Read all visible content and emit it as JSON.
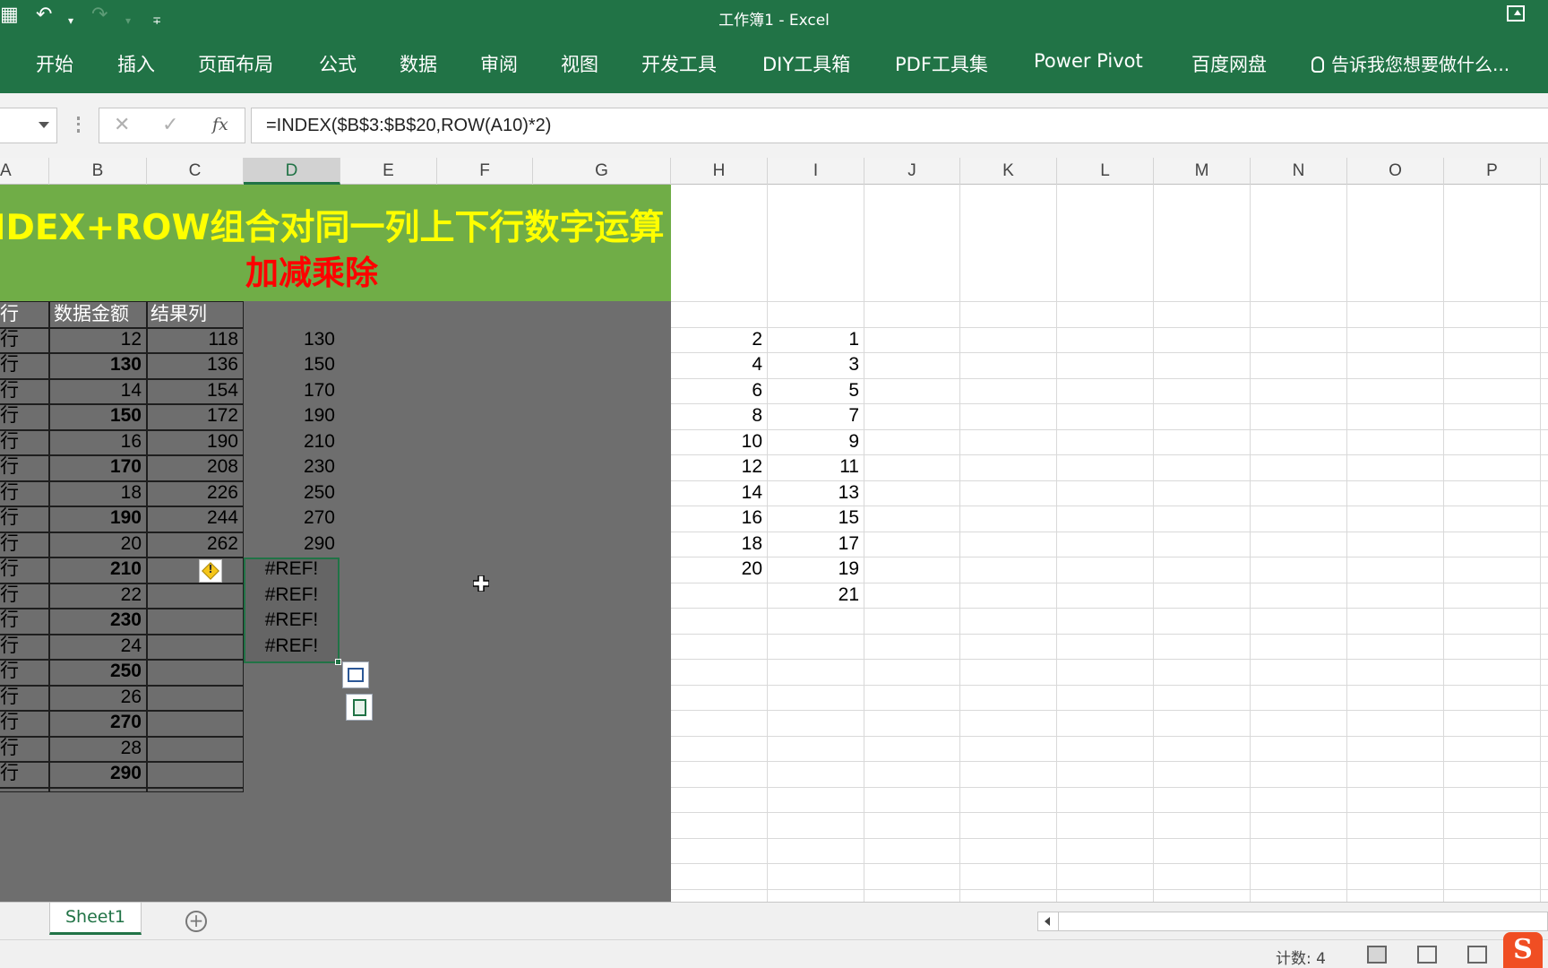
{
  "window": {
    "title": "工作簿1 - Excel"
  },
  "quick_access": {
    "undo": "↶",
    "redo": "↷",
    "dropdown": "▾",
    "customize": "∓"
  },
  "ribbon": {
    "tabs": [
      "开始",
      "插入",
      "页面布局",
      "公式",
      "数据",
      "审阅",
      "视图",
      "开发工具",
      "DIY工具箱",
      "PDF工具集",
      "Power Pivot",
      "百度网盘"
    ],
    "tell_me": "告诉我您想要做什么..."
  },
  "formula_bar": {
    "cancel": "✕",
    "enter": "✓",
    "fx": "fx",
    "formula": "=INDEX($B$3:$B$20,ROW(A10)*2)"
  },
  "columns": [
    "A",
    "B",
    "C",
    "D",
    "E",
    "F",
    "G",
    "H",
    "I",
    "J",
    "K",
    "L",
    "M",
    "N",
    "O",
    "P"
  ],
  "banner": {
    "line1": "IDEX+ROW组合对同一列上下行数字运算",
    "line2": "加减乘除"
  },
  "table": {
    "headers": [
      "行",
      "数据金额",
      "结果列"
    ],
    "rows": [
      {
        "a": "行",
        "b": "12",
        "c": "118"
      },
      {
        "a": "行",
        "b": "130",
        "c": "136"
      },
      {
        "a": "行",
        "b": "14",
        "c": "154"
      },
      {
        "a": "行",
        "b": "150",
        "c": "172"
      },
      {
        "a": "行",
        "b": "16",
        "c": "190"
      },
      {
        "a": "行",
        "b": "170",
        "c": "208"
      },
      {
        "a": "行",
        "b": "18",
        "c": "226"
      },
      {
        "a": "行",
        "b": "190",
        "c": "244"
      },
      {
        "a": "行",
        "b": "20",
        "c": "262"
      },
      {
        "a": "行",
        "b": "210",
        "c": ""
      },
      {
        "a": "行",
        "b": "22",
        "c": ""
      },
      {
        "a": "行",
        "b": "230",
        "c": ""
      },
      {
        "a": "行",
        "b": "24",
        "c": ""
      },
      {
        "a": "行",
        "b": "250",
        "c": ""
      },
      {
        "a": "行",
        "b": "26",
        "c": ""
      },
      {
        "a": "行",
        "b": "270",
        "c": ""
      },
      {
        "a": "行",
        "b": "28",
        "c": ""
      },
      {
        "a": "行",
        "b": "290",
        "c": ""
      }
    ]
  },
  "column_d": [
    "130",
    "150",
    "170",
    "190",
    "210",
    "230",
    "250",
    "270",
    "290",
    "#REF!",
    "#REF!",
    "#REF!",
    "#REF!"
  ],
  "column_h": [
    "2",
    "4",
    "6",
    "8",
    "10",
    "12",
    "14",
    "16",
    "18",
    "20"
  ],
  "column_i": [
    "1",
    "3",
    "5",
    "7",
    "9",
    "11",
    "13",
    "15",
    "17",
    "19",
    "21"
  ],
  "sheets": {
    "active": "Sheet1",
    "add": "+"
  },
  "status": {
    "count": "计数: 4"
  },
  "ime": {
    "logo": "S"
  }
}
